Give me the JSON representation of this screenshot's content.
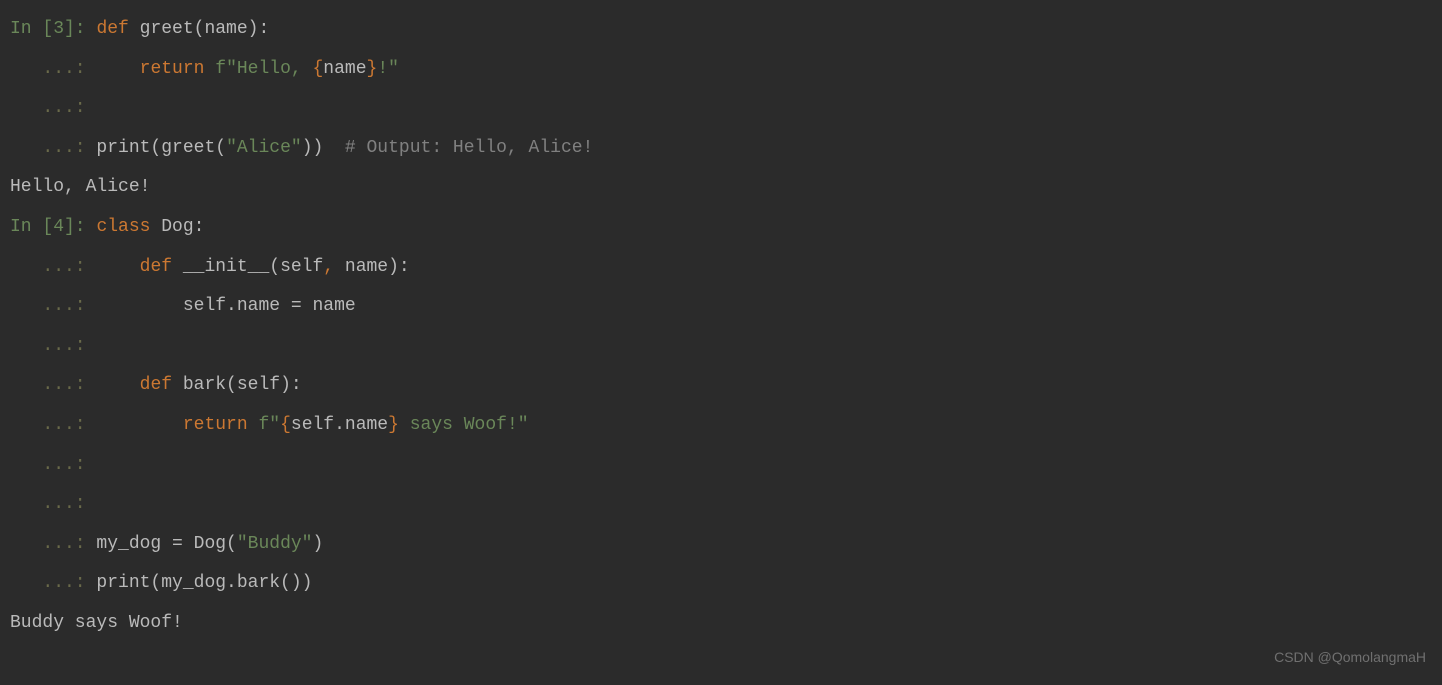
{
  "cells": [
    {
      "prompt": "In [3]:",
      "tokens_line1": [
        {
          "t": " ",
          "cls": ""
        },
        {
          "t": "def",
          "cls": "keyword"
        },
        {
          "t": " greet(name):",
          "cls": "identifier"
        }
      ],
      "cont_lines": [
        [
          {
            "t": "     ",
            "cls": ""
          },
          {
            "t": "return",
            "cls": "keyword"
          },
          {
            "t": " ",
            "cls": ""
          },
          {
            "t": "f\"Hello, ",
            "cls": "string"
          },
          {
            "t": "{",
            "cls": "fstring-brace"
          },
          {
            "t": "name",
            "cls": "fstring-var"
          },
          {
            "t": "}",
            "cls": "fstring-brace"
          },
          {
            "t": "!\"",
            "cls": "string"
          }
        ],
        [],
        [
          {
            "t": " print(greet(",
            "cls": "identifier"
          },
          {
            "t": "\"Alice\"",
            "cls": "string"
          },
          {
            "t": "))  ",
            "cls": "identifier"
          },
          {
            "t": "# Output: Hello, Alice!",
            "cls": "comment"
          }
        ]
      ],
      "output": "Hello, Alice!"
    },
    {
      "prompt": "In [4]:",
      "tokens_line1": [
        {
          "t": " ",
          "cls": ""
        },
        {
          "t": "class",
          "cls": "keyword"
        },
        {
          "t": " Dog:",
          "cls": "identifier"
        }
      ],
      "cont_lines": [
        [
          {
            "t": "     ",
            "cls": ""
          },
          {
            "t": "def",
            "cls": "keyword"
          },
          {
            "t": " __init__(self",
            "cls": "identifier"
          },
          {
            "t": ",",
            "cls": "keyword"
          },
          {
            "t": " name):",
            "cls": "identifier"
          }
        ],
        [
          {
            "t": "         self.name = name",
            "cls": "identifier"
          }
        ],
        [],
        [
          {
            "t": "     ",
            "cls": ""
          },
          {
            "t": "def",
            "cls": "keyword"
          },
          {
            "t": " bark(self):",
            "cls": "identifier"
          }
        ],
        [
          {
            "t": "         ",
            "cls": ""
          },
          {
            "t": "return",
            "cls": "keyword"
          },
          {
            "t": " ",
            "cls": ""
          },
          {
            "t": "f\"",
            "cls": "string"
          },
          {
            "t": "{",
            "cls": "fstring-brace"
          },
          {
            "t": "self.name",
            "cls": "fstring-var"
          },
          {
            "t": "}",
            "cls": "fstring-brace"
          },
          {
            "t": " says Woof!\"",
            "cls": "string"
          }
        ],
        [],
        [],
        [
          {
            "t": " my_dog = Dog(",
            "cls": "identifier"
          },
          {
            "t": "\"Buddy\"",
            "cls": "string"
          },
          {
            "t": ")",
            "cls": "identifier"
          }
        ],
        [
          {
            "t": " print(my_dog.bark())",
            "cls": "identifier"
          }
        ]
      ],
      "output": "Buddy says Woof!"
    }
  ],
  "continuation_prompt": "   ...:",
  "watermark": "CSDN @QomolangmaH"
}
